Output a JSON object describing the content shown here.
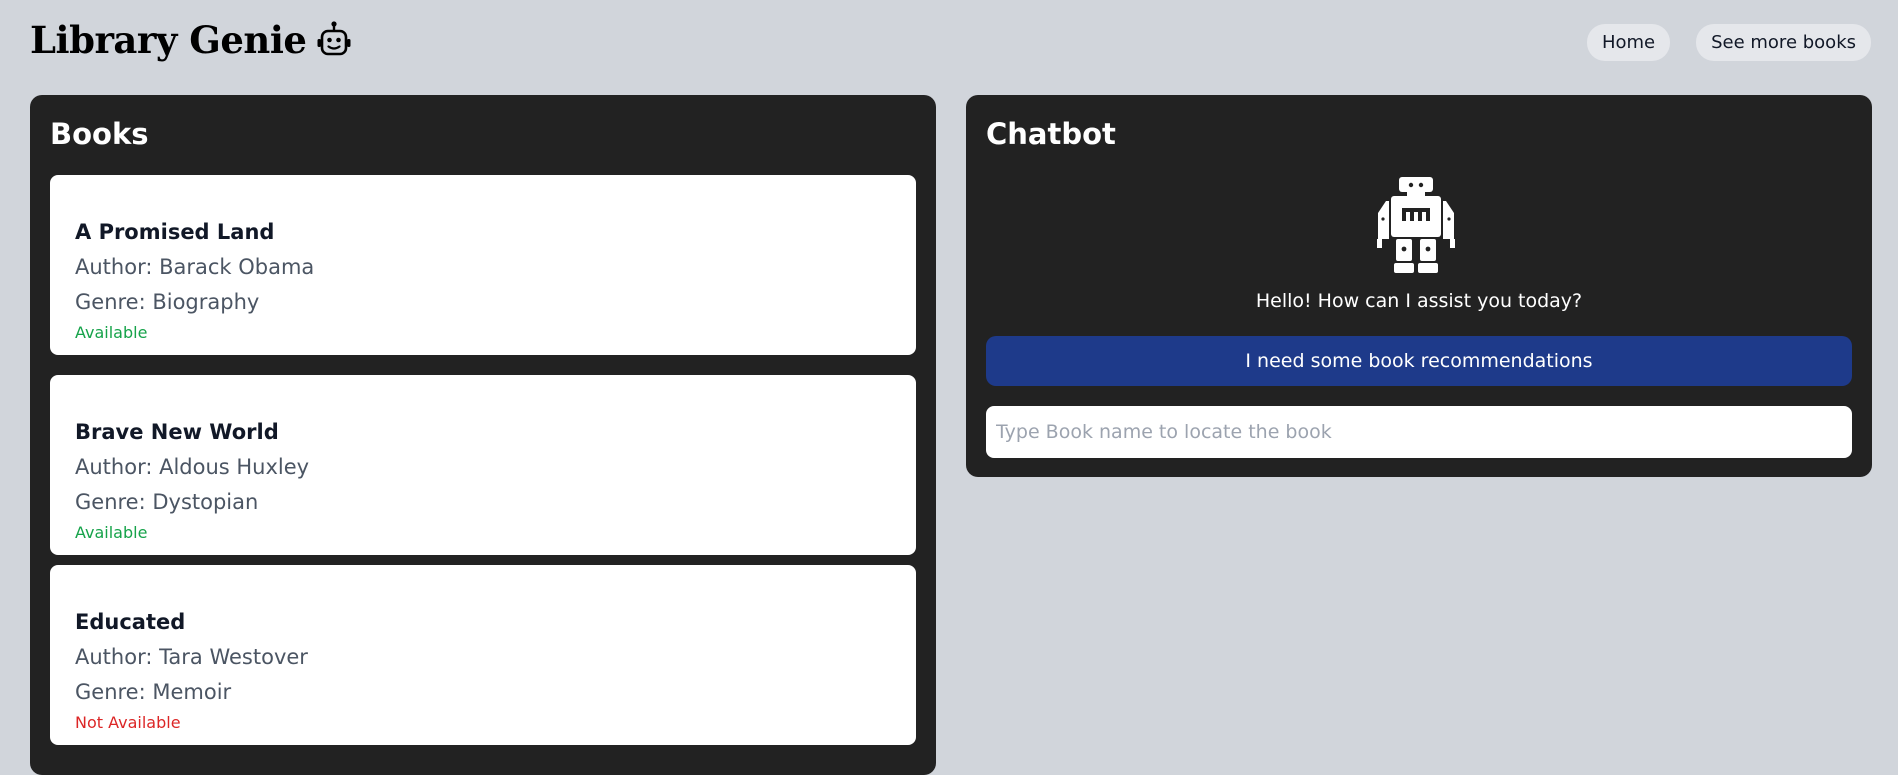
{
  "app": {
    "title": "Library Genie",
    "logo_icon": "robot-face-icon"
  },
  "nav": {
    "items": [
      {
        "label": "Home"
      },
      {
        "label": "See more books"
      }
    ]
  },
  "books": {
    "title": "Books",
    "items": [
      {
        "title": "A Promised Land",
        "author": "Author: Barack Obama",
        "genre": "Genre: Biography",
        "status": "Available",
        "status_color": "#16a34a"
      },
      {
        "title": "Brave New World",
        "author": "Author: Aldous Huxley",
        "genre": "Genre: Dystopian",
        "status": "Available",
        "status_color": "#16a34a"
      },
      {
        "title": "Educated",
        "author": "Author: Tara Westover",
        "genre": "Genre: Memoir",
        "status": "Not Available",
        "status_color": "#dc2626"
      }
    ]
  },
  "chatbot": {
    "title": "Chatbot",
    "avatar_icon": "robot-icon",
    "greeting": "Hello! How can I assist you today?",
    "recommend_label": "I need some book recommendations",
    "search": {
      "placeholder": "Type Book name to locate the book",
      "value": ""
    }
  },
  "colors": {
    "background": "#d1d5db",
    "panel": "#222222",
    "accent": "#1e3a8a",
    "available": "#16a34a",
    "unavailable": "#dc2626"
  }
}
